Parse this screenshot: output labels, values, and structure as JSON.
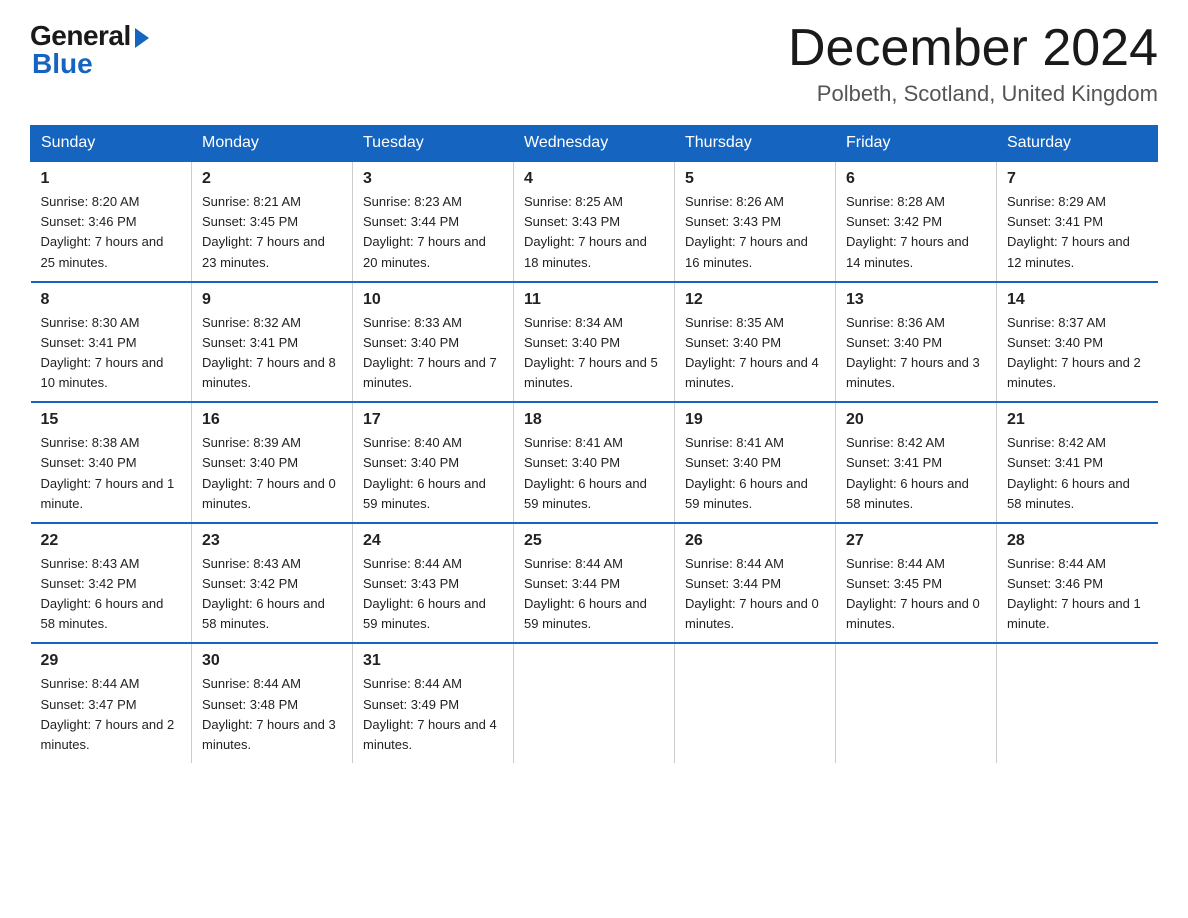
{
  "logo": {
    "general": "General",
    "blue": "Blue"
  },
  "title": "December 2024",
  "location": "Polbeth, Scotland, United Kingdom",
  "days_of_week": [
    "Sunday",
    "Monday",
    "Tuesday",
    "Wednesday",
    "Thursday",
    "Friday",
    "Saturday"
  ],
  "weeks": [
    [
      {
        "day": "1",
        "sunrise": "8:20 AM",
        "sunset": "3:46 PM",
        "daylight": "7 hours and 25 minutes."
      },
      {
        "day": "2",
        "sunrise": "8:21 AM",
        "sunset": "3:45 PM",
        "daylight": "7 hours and 23 minutes."
      },
      {
        "day": "3",
        "sunrise": "8:23 AM",
        "sunset": "3:44 PM",
        "daylight": "7 hours and 20 minutes."
      },
      {
        "day": "4",
        "sunrise": "8:25 AM",
        "sunset": "3:43 PM",
        "daylight": "7 hours and 18 minutes."
      },
      {
        "day": "5",
        "sunrise": "8:26 AM",
        "sunset": "3:43 PM",
        "daylight": "7 hours and 16 minutes."
      },
      {
        "day": "6",
        "sunrise": "8:28 AM",
        "sunset": "3:42 PM",
        "daylight": "7 hours and 14 minutes."
      },
      {
        "day": "7",
        "sunrise": "8:29 AM",
        "sunset": "3:41 PM",
        "daylight": "7 hours and 12 minutes."
      }
    ],
    [
      {
        "day": "8",
        "sunrise": "8:30 AM",
        "sunset": "3:41 PM",
        "daylight": "7 hours and 10 minutes."
      },
      {
        "day": "9",
        "sunrise": "8:32 AM",
        "sunset": "3:41 PM",
        "daylight": "7 hours and 8 minutes."
      },
      {
        "day": "10",
        "sunrise": "8:33 AM",
        "sunset": "3:40 PM",
        "daylight": "7 hours and 7 minutes."
      },
      {
        "day": "11",
        "sunrise": "8:34 AM",
        "sunset": "3:40 PM",
        "daylight": "7 hours and 5 minutes."
      },
      {
        "day": "12",
        "sunrise": "8:35 AM",
        "sunset": "3:40 PM",
        "daylight": "7 hours and 4 minutes."
      },
      {
        "day": "13",
        "sunrise": "8:36 AM",
        "sunset": "3:40 PM",
        "daylight": "7 hours and 3 minutes."
      },
      {
        "day": "14",
        "sunrise": "8:37 AM",
        "sunset": "3:40 PM",
        "daylight": "7 hours and 2 minutes."
      }
    ],
    [
      {
        "day": "15",
        "sunrise": "8:38 AM",
        "sunset": "3:40 PM",
        "daylight": "7 hours and 1 minute."
      },
      {
        "day": "16",
        "sunrise": "8:39 AM",
        "sunset": "3:40 PM",
        "daylight": "7 hours and 0 minutes."
      },
      {
        "day": "17",
        "sunrise": "8:40 AM",
        "sunset": "3:40 PM",
        "daylight": "6 hours and 59 minutes."
      },
      {
        "day": "18",
        "sunrise": "8:41 AM",
        "sunset": "3:40 PM",
        "daylight": "6 hours and 59 minutes."
      },
      {
        "day": "19",
        "sunrise": "8:41 AM",
        "sunset": "3:40 PM",
        "daylight": "6 hours and 59 minutes."
      },
      {
        "day": "20",
        "sunrise": "8:42 AM",
        "sunset": "3:41 PM",
        "daylight": "6 hours and 58 minutes."
      },
      {
        "day": "21",
        "sunrise": "8:42 AM",
        "sunset": "3:41 PM",
        "daylight": "6 hours and 58 minutes."
      }
    ],
    [
      {
        "day": "22",
        "sunrise": "8:43 AM",
        "sunset": "3:42 PM",
        "daylight": "6 hours and 58 minutes."
      },
      {
        "day": "23",
        "sunrise": "8:43 AM",
        "sunset": "3:42 PM",
        "daylight": "6 hours and 58 minutes."
      },
      {
        "day": "24",
        "sunrise": "8:44 AM",
        "sunset": "3:43 PM",
        "daylight": "6 hours and 59 minutes."
      },
      {
        "day": "25",
        "sunrise": "8:44 AM",
        "sunset": "3:44 PM",
        "daylight": "6 hours and 59 minutes."
      },
      {
        "day": "26",
        "sunrise": "8:44 AM",
        "sunset": "3:44 PM",
        "daylight": "7 hours and 0 minutes."
      },
      {
        "day": "27",
        "sunrise": "8:44 AM",
        "sunset": "3:45 PM",
        "daylight": "7 hours and 0 minutes."
      },
      {
        "day": "28",
        "sunrise": "8:44 AM",
        "sunset": "3:46 PM",
        "daylight": "7 hours and 1 minute."
      }
    ],
    [
      {
        "day": "29",
        "sunrise": "8:44 AM",
        "sunset": "3:47 PM",
        "daylight": "7 hours and 2 minutes."
      },
      {
        "day": "30",
        "sunrise": "8:44 AM",
        "sunset": "3:48 PM",
        "daylight": "7 hours and 3 minutes."
      },
      {
        "day": "31",
        "sunrise": "8:44 AM",
        "sunset": "3:49 PM",
        "daylight": "7 hours and 4 minutes."
      },
      null,
      null,
      null,
      null
    ]
  ],
  "labels": {
    "sunrise": "Sunrise:",
    "sunset": "Sunset:",
    "daylight": "Daylight:"
  }
}
